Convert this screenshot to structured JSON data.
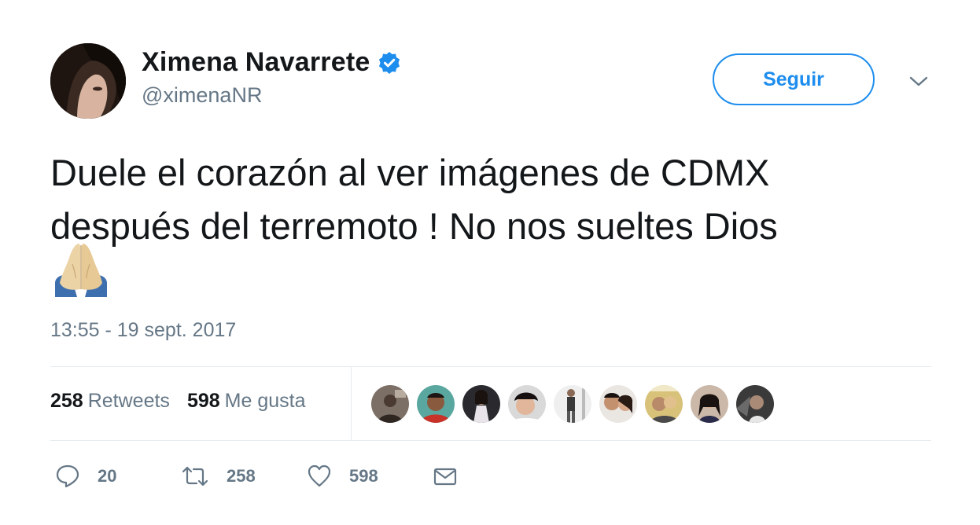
{
  "author": {
    "display_name": "Ximena Navarrete",
    "handle": "@ximenaNR",
    "verified": true,
    "avatar": "profile-photo"
  },
  "follow_button": {
    "label": "Seguir"
  },
  "more_menu": {
    "icon": "chevron-down-icon"
  },
  "tweet": {
    "text": "Duele el corazón al ver imágenes de CDMX\ndespués del terremoto ! No nos sueltes Dios",
    "emoji": "folded-hands",
    "timestamp": "13:55 - 19 sept. 2017"
  },
  "stats": {
    "retweets_count": "258",
    "retweets_label": "Retweets",
    "likes_count": "598",
    "likes_label": "Me gusta"
  },
  "likers": [
    "liker-avatar-1",
    "liker-avatar-2",
    "liker-avatar-3",
    "liker-avatar-4",
    "liker-avatar-5",
    "liker-avatar-6",
    "liker-avatar-7",
    "liker-avatar-8",
    "liker-avatar-9"
  ],
  "actions": {
    "reply_count": "20",
    "retweet_count": "258",
    "like_count": "598"
  },
  "colors": {
    "accent": "#1d8dee",
    "text": "#14171a",
    "secondary": "#657786",
    "divider": "#e6ecf0"
  }
}
